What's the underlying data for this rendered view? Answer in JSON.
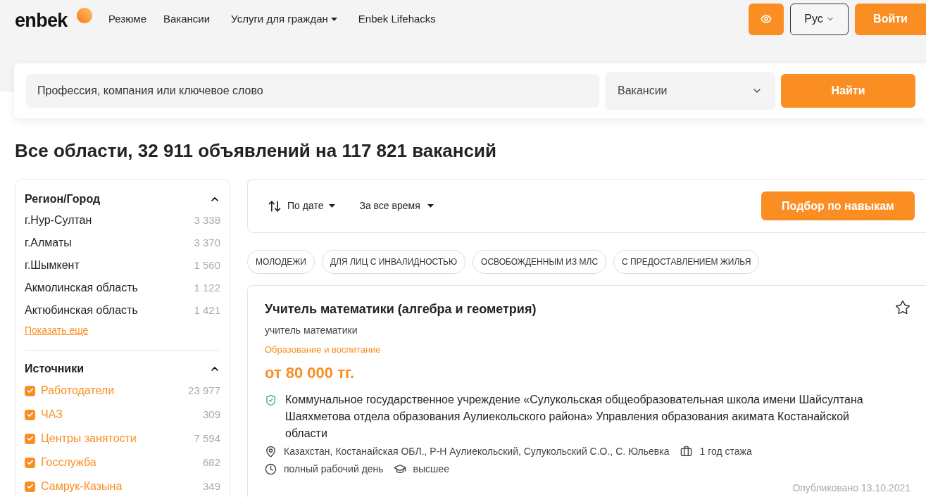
{
  "header": {
    "logo": "enbek",
    "nav": [
      {
        "label": "Резюме",
        "dropdown": false
      },
      {
        "label": "Вакансии",
        "dropdown": false
      },
      {
        "label": "Услуги для граждан",
        "dropdown": true
      },
      {
        "label": "Enbek Lifehacks",
        "dropdown": false
      }
    ],
    "language": "Рус",
    "login": "Войти"
  },
  "search": {
    "placeholder": "Профессия, компания или ключевое слово",
    "type": "Вакансии",
    "button": "Найти"
  },
  "heading": "Все области, 32 911 объявлений на 117 821 вакансий",
  "filters": [
    {
      "title": "Регион/Город",
      "expanded": true,
      "items": [
        {
          "kind": "plain",
          "label": "г.Нур-Султан",
          "count": "3 338"
        },
        {
          "kind": "plain",
          "label": "г.Алматы",
          "count": "3 370"
        },
        {
          "kind": "plain",
          "label": "г.Шымкент",
          "count": "1 560"
        },
        {
          "kind": "plain",
          "label": "Акмолинская область",
          "count": "1 122"
        },
        {
          "kind": "plain",
          "label": "Актюбинская область",
          "count": "1 421"
        }
      ],
      "more": "Показать еще"
    },
    {
      "title": "Источники",
      "expanded": true,
      "items": [
        {
          "kind": "checkbox",
          "label": "Работодатели",
          "count": "23 977",
          "checked": true
        },
        {
          "kind": "checkbox",
          "label": "ЧАЗ",
          "count": "309",
          "checked": true
        },
        {
          "kind": "checkbox",
          "label": "Центры занятости",
          "count": "7 594",
          "checked": true
        },
        {
          "kind": "checkbox",
          "label": "Госслужба",
          "count": "682",
          "checked": true
        },
        {
          "kind": "checkbox",
          "label": "Самрук-Казына",
          "count": "349",
          "checked": true
        }
      ]
    }
  ],
  "toolbar": {
    "sort": "По дате",
    "period": "За все время",
    "skills_button": "Подбор по навыкам"
  },
  "tags": [
    "МОЛОДЕЖИ",
    "ДЛЯ ЛИЦ С ИНВАЛИДНОСТЬЮ",
    "ОСВОБОЖДЕННЫМ ИЗ МЛС",
    "С ПРЕДОСТАВЛЕНИЕМ ЖИЛЬЯ"
  ],
  "vacancies": [
    {
      "title": "Учитель математики (алгебра и геометрия)",
      "position": "учитель математики",
      "category": "Образование и воспитание",
      "salary": "от 80 000 тг.",
      "favorite": false,
      "verified": true,
      "employer": "Коммунальное государственное учреждение «Сулукольская общеобразовательная школа имени Шайсултана Шаяхметова отдела образования Аулиекольского района» Управления образования акимата Костанайской области",
      "location": "Казахстан, Костанайская ОБЛ., Р-Н Аулиекольский, Сулукольский С.О., С. Юльевка",
      "experience": "1 год стажа",
      "schedule": "полный рабочий день",
      "education": "высшее",
      "published": "Опубликовано 13.10.2021"
    }
  ]
}
